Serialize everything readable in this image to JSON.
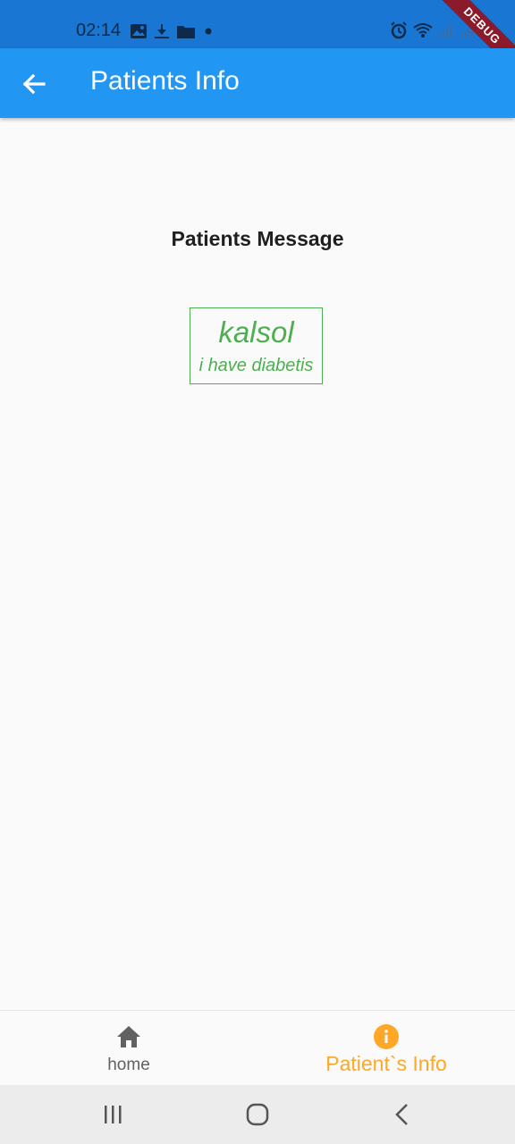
{
  "status_bar": {
    "time": "02:14",
    "left_icons": [
      "image-icon",
      "download-icon",
      "folder-icon",
      "dot-icon"
    ],
    "right_icons": [
      "alarm-icon",
      "wifi-icon",
      "signal-icon",
      "signal-icon",
      "battery-icon"
    ]
  },
  "debug_banner": "DEBUG",
  "app_bar": {
    "title": "Patients Info",
    "back_icon": "arrow-back-icon",
    "color": "#2196f3"
  },
  "content": {
    "section_title": "Patients Message",
    "message": {
      "name": "kalsol",
      "text": "i have diabetis",
      "color": "#4caf50"
    }
  },
  "bottom_nav": {
    "items": [
      {
        "label": "home",
        "icon": "home-icon",
        "selected": false
      },
      {
        "label": "Patient`s Info",
        "icon": "info-icon",
        "selected": true
      }
    ],
    "selected_color": "#ffa726",
    "unselected_color": "#616161"
  },
  "system_nav": {
    "buttons": [
      "recents-icon",
      "home-circle-icon",
      "back-chevron-icon"
    ]
  }
}
